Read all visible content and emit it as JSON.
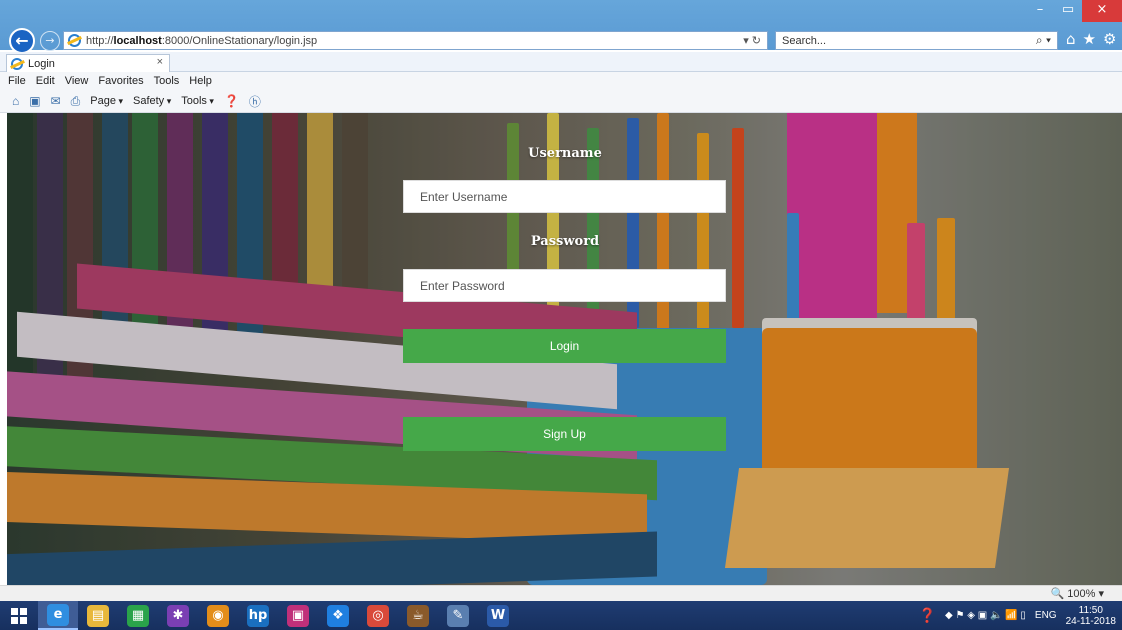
{
  "browser": {
    "address_scheme": "http://",
    "address_host": "localhost",
    "address_path": ":8000/OnlineStationary/login.jsp",
    "address_tail": "▾ ↻",
    "search_placeholder": "Search...",
    "tab_title": "Login",
    "tab_close": "×",
    "window_controls": [
      "–",
      "▭",
      "×"
    ],
    "toolbar_icons": [
      "⌂",
      "★",
      "⚙"
    ]
  },
  "menu": [
    "File",
    "Edit",
    "View",
    "Favorites",
    "Tools",
    "Help"
  ],
  "command_bar": {
    "icons": [
      "⌂",
      "▣",
      "✉",
      "⎙"
    ],
    "items": [
      "Page",
      "Safety",
      "Tools"
    ]
  },
  "login_form": {
    "username_label": "Username",
    "username_placeholder": "Enter Username",
    "password_label": "Password",
    "password_placeholder": "Enter Password",
    "login_button": "Login",
    "signup_button": "Sign Up"
  },
  "status_bar": {
    "zoom": "🔍 100%  ▾"
  },
  "taskbar": {
    "apps": [
      {
        "icon": "ie-icon",
        "glyph": "e",
        "color": "#2f8ee0",
        "active": true
      },
      {
        "icon": "file-explorer-icon",
        "glyph": "▤",
        "color": "#e8b83b",
        "active": false
      },
      {
        "icon": "store-icon",
        "glyph": "▦",
        "color": "#2aa34a",
        "active": false
      },
      {
        "icon": "paint-icon",
        "glyph": "✱",
        "color": "#7a3fb3",
        "active": false
      },
      {
        "icon": "media-icon",
        "glyph": "◉",
        "color": "#e38d1a",
        "active": false
      },
      {
        "icon": "hp-icon",
        "glyph": "hp",
        "color": "#1a6fc0",
        "active": false
      },
      {
        "icon": "remote-icon",
        "glyph": "▣",
        "color": "#c0307a",
        "active": false
      },
      {
        "icon": "dropbox-icon",
        "glyph": "❖",
        "color": "#1f7fe0",
        "active": false
      },
      {
        "icon": "chrome-icon",
        "glyph": "◎",
        "color": "#d94a3a",
        "active": false
      },
      {
        "icon": "java-icon",
        "glyph": "☕",
        "color": "#8a5a2b",
        "active": false
      },
      {
        "icon": "tools-icon",
        "glyph": "✎",
        "color": "#5a7fb0",
        "active": false
      },
      {
        "icon": "word-icon",
        "glyph": "W",
        "color": "#2b5aa8",
        "active": false
      }
    ]
  },
  "tray": {
    "language": "ENG",
    "time": "11:50",
    "date": "24-11-2018"
  },
  "colors": {
    "button_green": "#45a849",
    "titlebar_blue": "#5a9ad3",
    "taskbar_navy": "#1f3c72"
  }
}
